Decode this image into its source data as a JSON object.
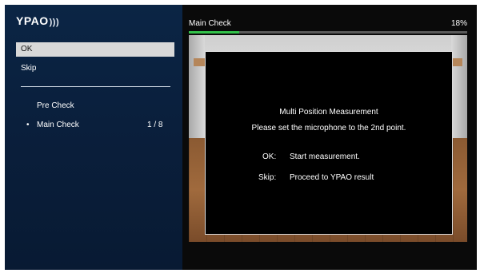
{
  "app": {
    "logo": "YPAO",
    "logo_mark": ")))"
  },
  "menu": {
    "ok_label": "OK",
    "skip_label": "Skip"
  },
  "steps": {
    "pre": "Pre Check",
    "bullet": "•",
    "main": "Main Check",
    "main_count": "1 / 8"
  },
  "status": {
    "title": "Main Check",
    "percent_text": "18%",
    "progress_fraction": 0.18,
    "progress_color": "#33c24a"
  },
  "dialog": {
    "title": "Multi Position Measurement",
    "message": "Please set the microphone to the 2nd point.",
    "ok_key": "OK:",
    "ok_text": "Start measurement.",
    "skip_key": "Skip:",
    "skip_text": "Proceed to YPAO result"
  }
}
